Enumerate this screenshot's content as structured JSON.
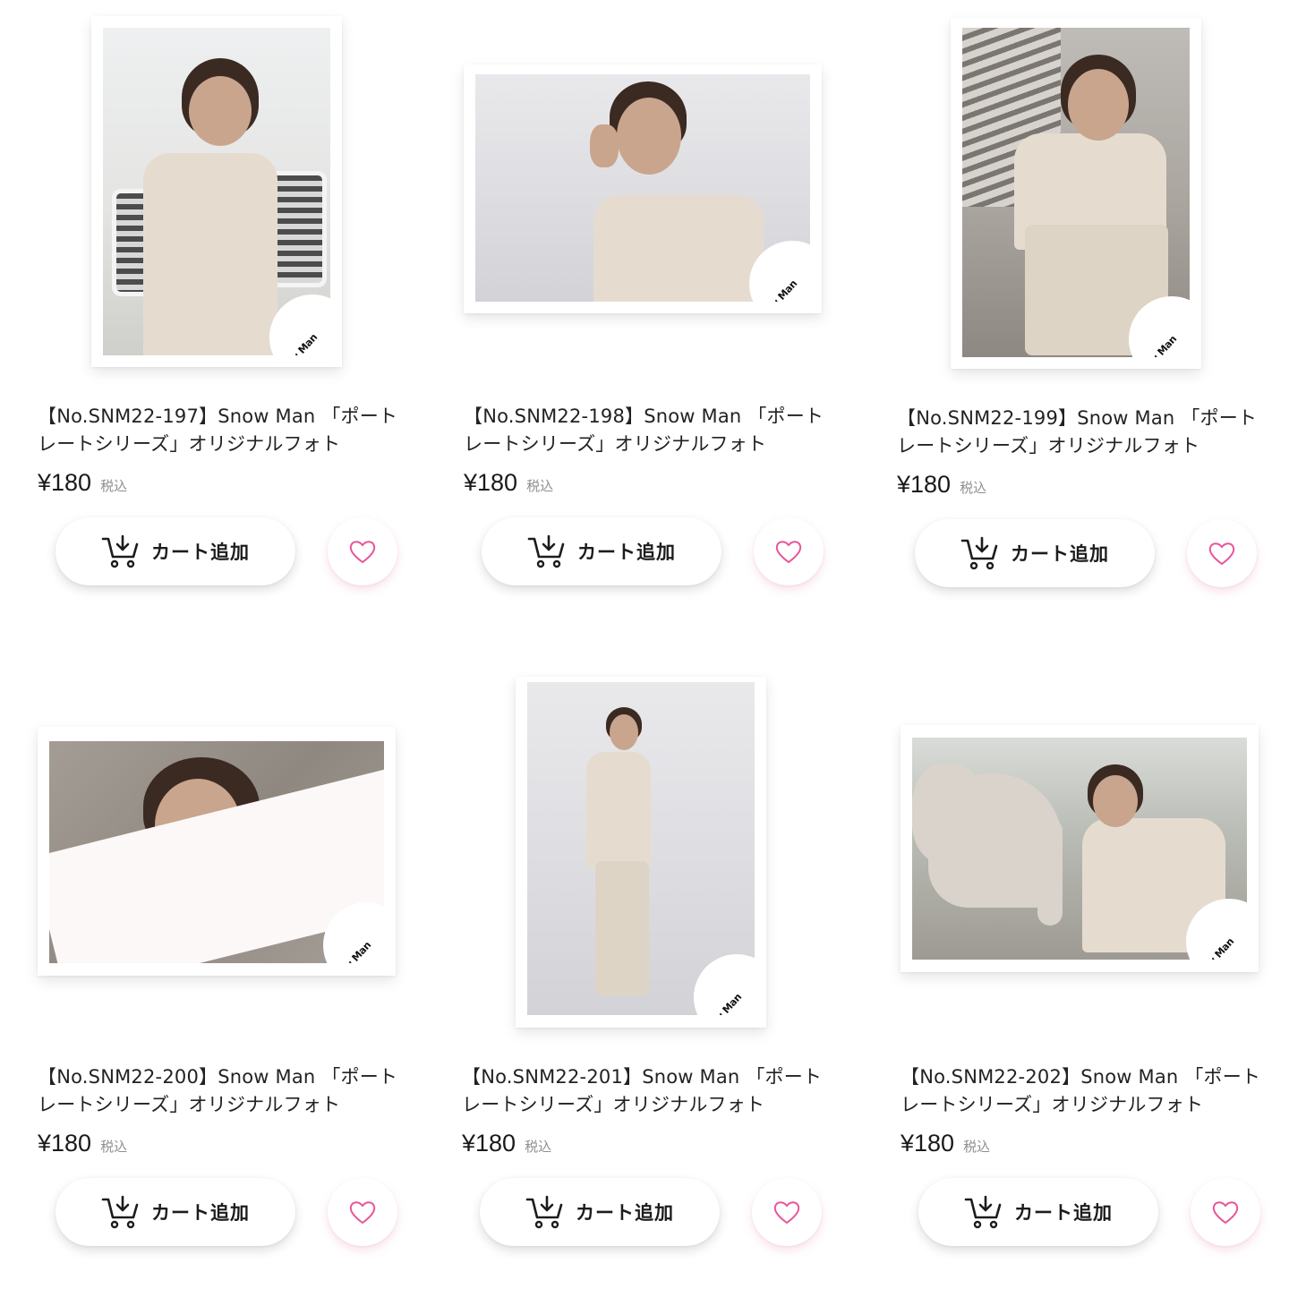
{
  "products": [
    {
      "title": "【No.SNM22-197】Snow Man 「ポートレートシリーズ」オリジナルフォト",
      "price": "¥180",
      "tax_label": "税込",
      "cart_label": "カート追加",
      "photo_logo": "Snow Man"
    },
    {
      "title": "【No.SNM22-198】Snow Man 「ポートレートシリーズ」オリジナルフォト",
      "price": "¥180",
      "tax_label": "税込",
      "cart_label": "カート追加",
      "photo_logo": "Snow Man"
    },
    {
      "title": "【No.SNM22-199】Snow Man 「ポートレートシリーズ」オリジナルフォト",
      "price": "¥180",
      "tax_label": "税込",
      "cart_label": "カート追加",
      "photo_logo": "Snow Man"
    },
    {
      "title": "【No.SNM22-200】Snow Man 「ポートレートシリーズ」オリジナルフォト",
      "price": "¥180",
      "tax_label": "税込",
      "cart_label": "カート追加",
      "photo_logo": "Snow Man"
    },
    {
      "title": "【No.SNM22-201】Snow Man 「ポートレートシリーズ」オリジナルフォト",
      "price": "¥180",
      "tax_label": "税込",
      "cart_label": "カート追加",
      "photo_logo": "Snow Man"
    },
    {
      "title": "【No.SNM22-202】Snow Man 「ポートレートシリーズ」オリジナルフォト",
      "price": "¥180",
      "tax_label": "税込",
      "cart_label": "カート追加",
      "photo_logo": "Snow Man"
    }
  ],
  "icons": {
    "cart": "cart-add-icon",
    "favorite": "heart-outline-icon"
  },
  "colors": {
    "heart": "#e8559a",
    "text": "#1a1a1a",
    "tax": "#8e8e8e"
  }
}
